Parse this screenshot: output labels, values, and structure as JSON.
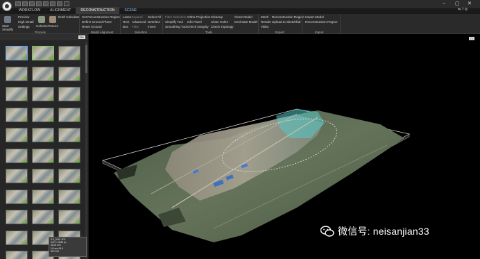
{
  "window": {
    "tabs": [
      "WORKFLOW",
      "ALIGNMENT",
      "RECONSTRUCTION",
      "SCENE"
    ],
    "controls": [
      "–",
      "▢",
      "✕"
    ]
  },
  "ribbon": {
    "process": {
      "title": "Process",
      "items": [
        "Preview",
        "High Detail",
        "Settings"
      ],
      "start_label": "Start",
      "colorize_label": "Colorize",
      "texture_label": "Texture",
      "simplify_label": "Simplify",
      "draft_calculate": "Draft Calculate"
    },
    "model_alignment": {
      "title": "Model Alignment",
      "items": [
        "Set Reconstruction Region",
        "Define Ground Plane",
        "Reset Ground"
      ]
    },
    "selection": {
      "title": "Selection",
      "col1": [
        "Lasso",
        "Rect",
        "Box"
      ],
      "col2": [
        "Expand",
        "Advanced",
        "Filter"
      ],
      "col3": [
        "Select All",
        "Deselect",
        "Invert"
      ]
    },
    "tools": {
      "title": "Tools",
      "col1": [
        "Filter Selection",
        "Simplify Tool",
        "Smoothing Tool"
      ],
      "col2": [
        "Ortho Projection",
        "Info Panel",
        "Check Integrity"
      ],
      "col3": [
        "Cleanup",
        "Close Holes",
        "Check Topology"
      ],
      "col4": [
        "Clone Model",
        "Decimate Model"
      ]
    },
    "export": {
      "title": "Export",
      "col1": [
        "Mesh",
        "Render",
        "Video"
      ],
      "col2": [
        "Reconstruction Region",
        "Upload to Sketchfab"
      ]
    },
    "import": {
      "title": "Import",
      "col1": [
        "Import Model",
        "Reconstruction Region"
      ]
    }
  },
  "sidebar": {
    "size_chip": "35x"
  },
  "tooltip": {
    "lines": [
      "DJI_0040.JPG",
      "5472 x 3648 px",
      "36.00 mm",
      "1/0 sec f/5.6",
      "ISO 100"
    ]
  },
  "viewport": {
    "chip": "▢"
  },
  "watermark": {
    "text": "微信号: neisanjian33"
  }
}
